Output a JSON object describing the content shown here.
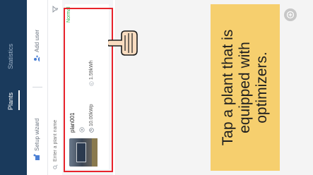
{
  "header": {
    "tabs": [
      {
        "label": "Plants",
        "active": true
      },
      {
        "label": "Statistics",
        "active": false
      }
    ]
  },
  "toolbar": {
    "setup_wizard_label": "Setup wizard",
    "add_user_label": "Add user"
  },
  "search": {
    "placeholder": "Enter a plant name"
  },
  "plants": [
    {
      "name": "plan001",
      "capacity": "10.00kWp",
      "energy": "1.59kWh",
      "status": "Normal"
    }
  ],
  "tip": {
    "text": "Tap a plant that is equipped with optimizers."
  },
  "colors": {
    "header_bg": "#1a3a5c",
    "highlight": "#e8232b",
    "tip_bg": "#f6cf6e",
    "status_normal": "#25b34b"
  },
  "icons": {
    "setup_wizard": "wizard-icon",
    "add_user": "add-user-icon",
    "search": "search-icon",
    "filter": "filter-icon",
    "pointer": "hand-pointer-icon",
    "plus": "plus-icon"
  }
}
